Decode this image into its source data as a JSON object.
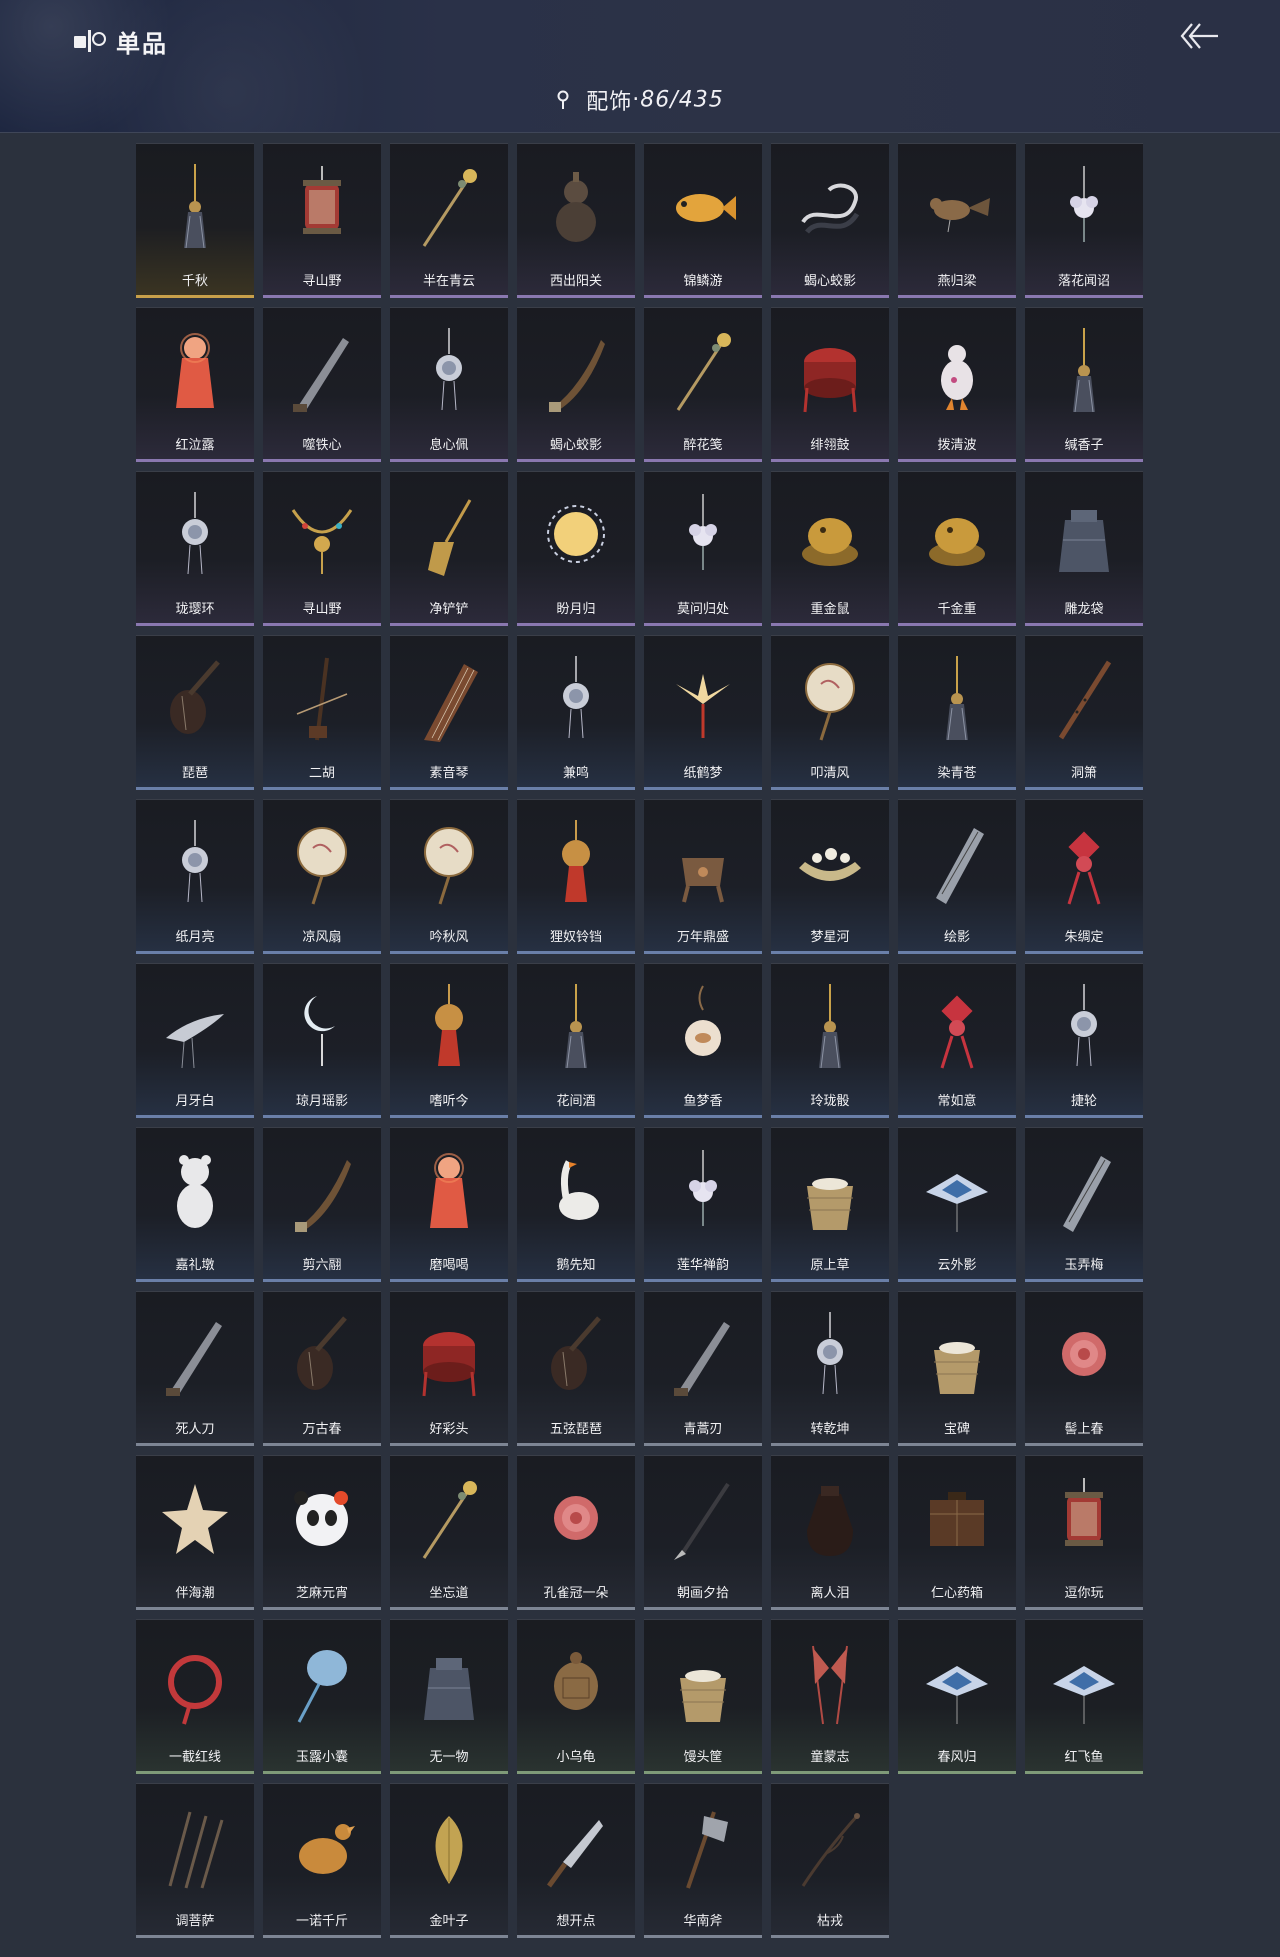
{
  "header": {
    "title": "单品",
    "category": "配饰",
    "separator": "·",
    "count": "86/435"
  },
  "icons": {
    "logo": "catalog-icon",
    "back": "back-arrow-icon",
    "pin": "location-pin-icon"
  },
  "colors": {
    "background": "#2b313d",
    "header": "#2a3148",
    "tile": "#1c1f26"
  },
  "items": [
    {
      "name": "千秋",
      "tint": "gold",
      "art": "tassel"
    },
    {
      "name": "寻山野",
      "tint": "purple",
      "art": "lantern"
    },
    {
      "name": "半在青云",
      "tint": "purple",
      "art": "pin"
    },
    {
      "name": "西出阳关",
      "tint": "purple",
      "art": "gourd"
    },
    {
      "name": "锦鳞游",
      "tint": "purple",
      "art": "fish"
    },
    {
      "name": "蝎心蛟影",
      "tint": "purple",
      "art": "snake"
    },
    {
      "name": "燕归梁",
      "tint": "purple",
      "art": "bird"
    },
    {
      "name": "落花闻诏",
      "tint": "purple",
      "art": "flower"
    },
    {
      "name": "红泣露",
      "tint": "purple",
      "art": "doll"
    },
    {
      "name": "噬铁心",
      "tint": "purple",
      "art": "blade"
    },
    {
      "name": "息心佩",
      "tint": "purple",
      "art": "pendant"
    },
    {
      "name": "蝎心蛟影",
      "tint": "purple",
      "art": "dagger"
    },
    {
      "name": "醉花笺",
      "tint": "purple",
      "art": "pin"
    },
    {
      "name": "绯翎鼓",
      "tint": "purple",
      "art": "drum"
    },
    {
      "name": "拨清波",
      "tint": "purple",
      "art": "duck"
    },
    {
      "name": "缄香子",
      "tint": "purple",
      "art": "tassel"
    },
    {
      "name": "珑璎环",
      "tint": "purple",
      "art": "pendant"
    },
    {
      "name": "寻山野",
      "tint": "purple",
      "art": "necklace"
    },
    {
      "name": "净铲铲",
      "tint": "purple",
      "art": "shovel"
    },
    {
      "name": "盼月归",
      "tint": "purple",
      "art": "moon"
    },
    {
      "name": "莫问归处",
      "tint": "purple",
      "art": "flower"
    },
    {
      "name": "重金鼠",
      "tint": "purple",
      "art": "gold"
    },
    {
      "name": "千金重",
      "tint": "purple",
      "art": "gold"
    },
    {
      "name": "雕龙袋",
      "tint": "purple",
      "art": "bag"
    },
    {
      "name": "琵琶",
      "tint": "blue",
      "art": "lute"
    },
    {
      "name": "二胡",
      "tint": "blue",
      "art": "erhu"
    },
    {
      "name": "素音琴",
      "tint": "blue",
      "art": "zither"
    },
    {
      "name": "兼鸣",
      "tint": "blue",
      "art": "pendant"
    },
    {
      "name": "纸鹤梦",
      "tint": "blue",
      "art": "crane"
    },
    {
      "name": "叩清风",
      "tint": "blue",
      "art": "fan"
    },
    {
      "name": "染青苍",
      "tint": "blue",
      "art": "tassel"
    },
    {
      "name": "洞箫",
      "tint": "blue",
      "art": "flute"
    },
    {
      "name": "纸月亮",
      "tint": "blue",
      "art": "pendant"
    },
    {
      "name": "凉风扇",
      "tint": "blue",
      "art": "fan"
    },
    {
      "name": "吟秋风",
      "tint": "blue",
      "art": "fan"
    },
    {
      "name": "狸奴铃铛",
      "tint": "blue",
      "art": "bell"
    },
    {
      "name": "万年鼎盛",
      "tint": "blue",
      "art": "cauldron"
    },
    {
      "name": "梦星河",
      "tint": "blue",
      "art": "boat"
    },
    {
      "name": "绘影",
      "tint": "blue",
      "art": "scroll"
    },
    {
      "name": "朱绸定",
      "tint": "blue",
      "art": "knot"
    },
    {
      "name": "月牙白",
      "tint": "blue",
      "art": "dragon"
    },
    {
      "name": "琼月瑶影",
      "tint": "blue",
      "art": "crescent"
    },
    {
      "name": "嗜听今",
      "tint": "blue",
      "art": "bell"
    },
    {
      "name": "花间酒",
      "tint": "blue",
      "art": "tassel"
    },
    {
      "name": "鱼梦香",
      "tint": "blue",
      "art": "vase"
    },
    {
      "name": "玲珑骰",
      "tint": "blue",
      "art": "tassel"
    },
    {
      "name": "常如意",
      "tint": "blue",
      "art": "knot"
    },
    {
      "name": "捷轮",
      "tint": "blue",
      "art": "pendant"
    },
    {
      "name": "嘉礼墩",
      "tint": "blue",
      "art": "bear"
    },
    {
      "name": "剪六翮",
      "tint": "blue",
      "art": "dagger"
    },
    {
      "name": "磨喝喝",
      "tint": "blue",
      "art": "doll"
    },
    {
      "name": "鹅先知",
      "tint": "blue",
      "art": "goose"
    },
    {
      "name": "莲华禅韵",
      "tint": "blue",
      "art": "flower"
    },
    {
      "name": "原上草",
      "tint": "blue",
      "art": "basket"
    },
    {
      "name": "云外影",
      "tint": "blue",
      "art": "kite"
    },
    {
      "name": "玉弄梅",
      "tint": "blue",
      "art": "scroll"
    },
    {
      "name": "死人刀",
      "tint": "gray",
      "art": "blade"
    },
    {
      "name": "万古春",
      "tint": "gray",
      "art": "lute"
    },
    {
      "name": "好彩头",
      "tint": "gray",
      "art": "drum"
    },
    {
      "name": "五弦琵琶",
      "tint": "gray",
      "art": "lute"
    },
    {
      "name": "青蒿刃",
      "tint": "gray",
      "art": "blade"
    },
    {
      "name": "转乾坤",
      "tint": "gray",
      "art": "pendant"
    },
    {
      "name": "宝碑",
      "tint": "gray",
      "art": "basket"
    },
    {
      "name": "髻上春",
      "tint": "gray",
      "art": "rose"
    },
    {
      "name": "伴海潮",
      "tint": "gray",
      "art": "star"
    },
    {
      "name": "芝麻元宵",
      "tint": "gray",
      "art": "panda"
    },
    {
      "name": "坐忘道",
      "tint": "gray",
      "art": "pin"
    },
    {
      "name": "孔雀冠一朵",
      "tint": "gray",
      "art": "rose"
    },
    {
      "name": "朝画夕拾",
      "tint": "gray",
      "art": "brush"
    },
    {
      "name": "离人泪",
      "tint": "gray",
      "art": "jar"
    },
    {
      "name": "仁心药箱",
      "tint": "gray",
      "art": "box"
    },
    {
      "name": "逗你玩",
      "tint": "gray",
      "art": "lantern"
    },
    {
      "name": "一截红线",
      "tint": "green",
      "art": "rope"
    },
    {
      "name": "玉露小囊",
      "tint": "green",
      "art": "pouch"
    },
    {
      "name": "无一物",
      "tint": "green",
      "art": "bag"
    },
    {
      "name": "小乌龟",
      "tint": "green",
      "art": "turtle"
    },
    {
      "name": "馒头筐",
      "tint": "green",
      "art": "basket"
    },
    {
      "name": "童蒙志",
      "tint": "green",
      "art": "flags"
    },
    {
      "name": "春风归",
      "tint": "green",
      "art": "kite"
    },
    {
      "name": "红飞鱼",
      "tint": "green",
      "art": "kite"
    },
    {
      "name": "调菩萨",
      "tint": "gray",
      "art": "darts"
    },
    {
      "name": "一诺千斤",
      "tint": "gray",
      "art": "chicken"
    },
    {
      "name": "金叶子",
      "tint": "gray",
      "art": "leaf"
    },
    {
      "name": "想开点",
      "tint": "gray",
      "art": "knife"
    },
    {
      "name": "华南斧",
      "tint": "gray",
      "art": "axe"
    },
    {
      "name": "枯戎",
      "tint": "gray",
      "art": "branch"
    }
  ]
}
